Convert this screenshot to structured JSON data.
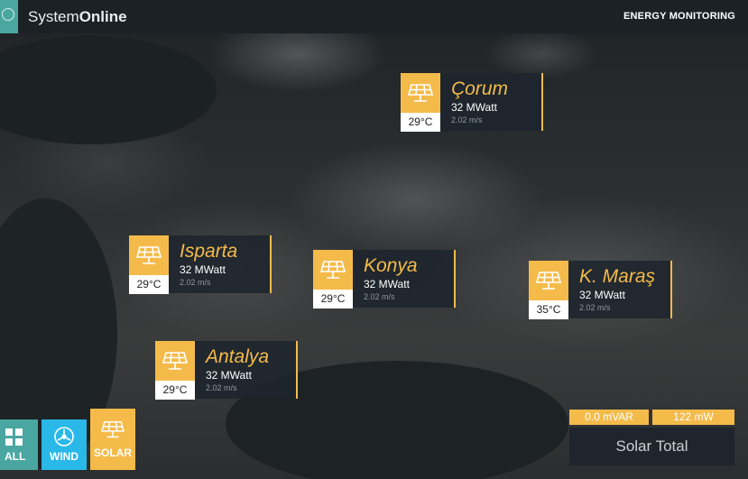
{
  "header": {
    "brand_light": "System",
    "brand_bold": "Online",
    "section": "ENERGY MONITORING"
  },
  "cities": [
    {
      "name": "Çorum",
      "power": "32 MWatt",
      "wind": "2.02 m/s",
      "temp": "29°C"
    },
    {
      "name": "Isparta",
      "power": "32 MWatt",
      "wind": "2.02 m/s",
      "temp": "29°C"
    },
    {
      "name": "Konya",
      "power": "32 MWatt",
      "wind": "2.02 m/s",
      "temp": "29°C"
    },
    {
      "name": "K. Maraş",
      "power": "32 MWatt",
      "wind": "2.02 m/s",
      "temp": "35°C"
    },
    {
      "name": "Antalya",
      "power": "32 MWatt",
      "wind": "2.02 m/s",
      "temp": "29°C"
    }
  ],
  "filters": [
    {
      "label": "ALL",
      "icon": "grid-icon"
    },
    {
      "label": "WIND",
      "icon": "wind-turbine-icon"
    },
    {
      "label": "SOLAR",
      "icon": "solar-panel-icon"
    }
  ],
  "summary": {
    "reactive": "0.0 mVAR",
    "active": "122 mW",
    "title": "Solar Total"
  },
  "colors": {
    "accent": "#f4bb4a",
    "teal": "#4aa6a0",
    "wind_blue": "#2ab8e8",
    "header_bg": "#1b2226"
  }
}
